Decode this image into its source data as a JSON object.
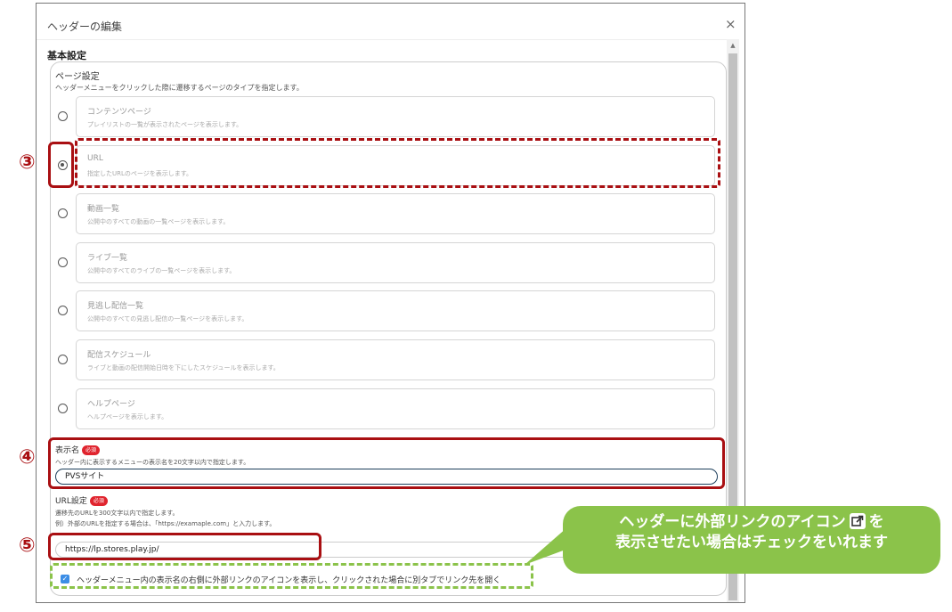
{
  "dialog": {
    "title": "ヘッダーの編集",
    "close_glyph": "×",
    "section_title": "基本設定"
  },
  "page_setting": {
    "label": "ページ設定",
    "description": "ヘッダーメニューをクリックした際に遷移するページのタイプを指定します。",
    "selected": "URL",
    "options": [
      {
        "title": "コンテンツページ",
        "desc": "プレイリストの一覧が表示されたページを表示します。",
        "checked": false
      },
      {
        "title": "URL",
        "desc": "指定したURLのページを表示します。",
        "checked": true
      },
      {
        "title": "動画一覧",
        "desc": "公開中のすべての動画の一覧ページを表示します。",
        "checked": false
      },
      {
        "title": "ライブ一覧",
        "desc": "公開中のすべてのライブの一覧ページを表示します。",
        "checked": false
      },
      {
        "title": "見逃し配信一覧",
        "desc": "公開中のすべての見逃し配信の一覧ページを表示します。",
        "checked": false
      },
      {
        "title": "配信スケジュール",
        "desc": "ライブと動画の配信開始日時を下にしたスケジュールを表示します。",
        "checked": false
      },
      {
        "title": "ヘルプページ",
        "desc": "ヘルプページを表示します。",
        "checked": false
      }
    ]
  },
  "display_name": {
    "label": "表示名",
    "required_badge": "必須",
    "description": "ヘッダー内に表示するメニューの表示名を20文字以内で指定します。",
    "value": "PVSサイト"
  },
  "url_setting": {
    "label": "URL設定",
    "required_badge": "必須",
    "desc_line1": "遷移先のURLを300文字以内で指定します。",
    "desc_line2": "例）外部のURLを指定する場合は、「https://examaple.com」と入力します。",
    "value": "https://lp.stores.play.jp/"
  },
  "external_link": {
    "checked": true,
    "label": "ヘッダーメニュー内の表示名の右側に外部リンクのアイコンを表示し、クリックされた場合に別タブでリンク先を開く"
  },
  "annotations": {
    "marker_3": "③",
    "marker_4": "④",
    "marker_5": "⑤",
    "callout_line1_before": "ヘッダーに外部リンクのアイコン",
    "callout_line1_after": "を",
    "callout_line2": "表示させたい場合はチェックをいれます",
    "icon": "external-link-icon",
    "colors": {
      "highlight_red": "#a90f12",
      "callout_green": "#8bc34a",
      "checkbox_blue": "#3c8ee6",
      "badge_red": "#e0242e"
    }
  }
}
